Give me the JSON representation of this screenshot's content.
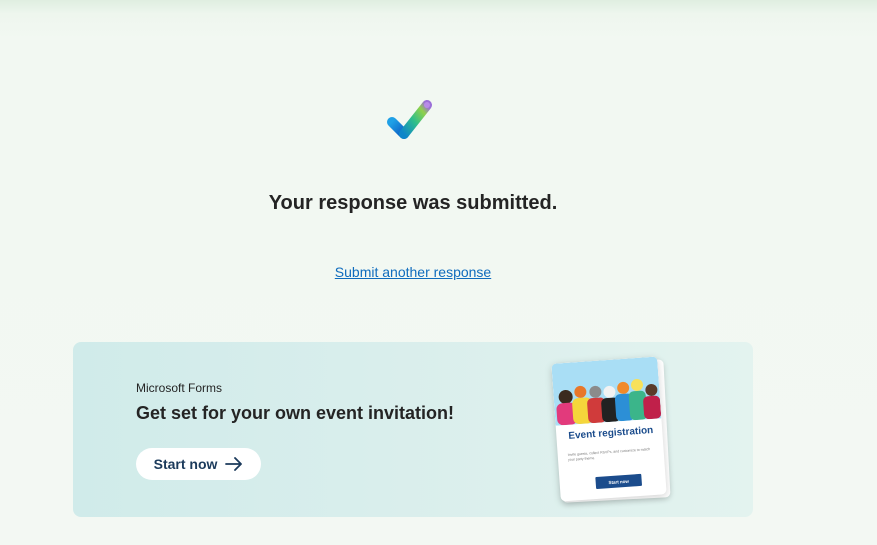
{
  "confirmation": {
    "icon": "checkmark-icon",
    "message": "Your response was submitted.",
    "submit_another_label": "Submit another response"
  },
  "promo": {
    "brand": "Microsoft Forms",
    "title": "Get set for your own event invitation!",
    "start_label": "Start now",
    "start_icon": "arrow-right-icon",
    "card": {
      "title": "Event registration",
      "description": "Invite guests, collect RSVPs, and customize to match your party theme.",
      "button_label": "Start now"
    }
  },
  "colors": {
    "link": "#0f6cbd",
    "promo_bg": "#d4ecea",
    "card_accent": "#1b4c8c",
    "button_text": "#1b3a5b"
  }
}
